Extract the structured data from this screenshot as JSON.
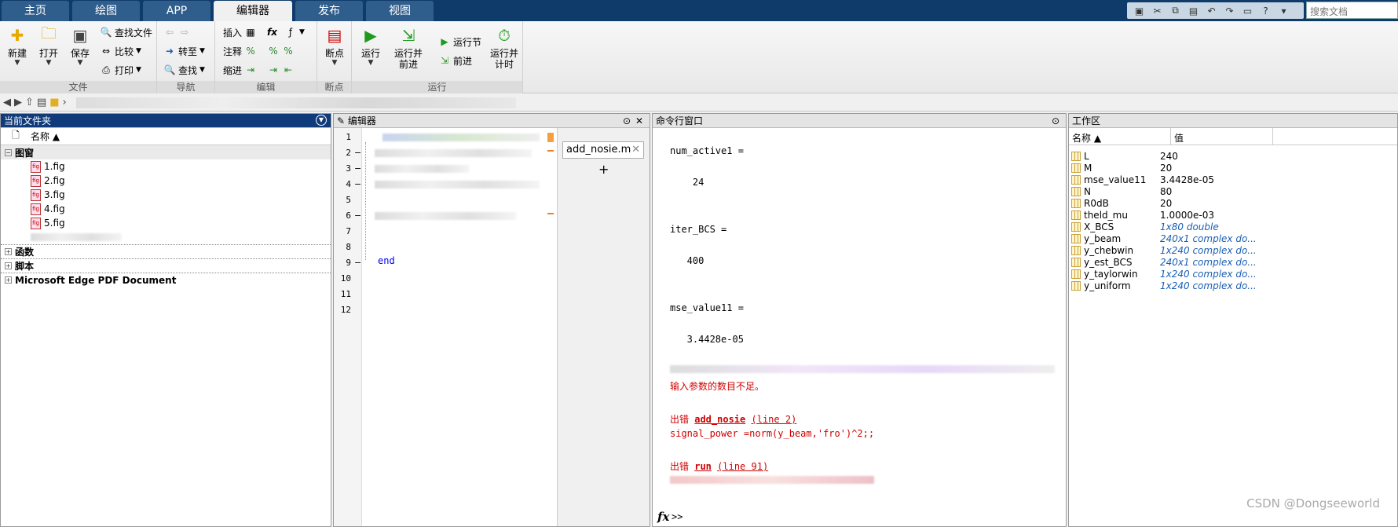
{
  "tabs": [
    {
      "label": "主页",
      "active": false
    },
    {
      "label": "绘图",
      "active": false
    },
    {
      "label": "APP",
      "active": false
    },
    {
      "label": "编辑器",
      "active": true
    },
    {
      "label": "发布",
      "active": false
    },
    {
      "label": "视图",
      "active": false
    }
  ],
  "search_placeholder": "搜索文档",
  "toolstrip": {
    "file": {
      "title": "文件",
      "new": "新建",
      "open": "打开",
      "save": "保存",
      "find_files": "查找文件",
      "compare": "比较",
      "print": "打印"
    },
    "nav": {
      "title": "导航",
      "goto": "转至",
      "find": "查找"
    },
    "edit": {
      "title": "编辑",
      "insert": "插入",
      "comment": "注释",
      "indent": "缩进",
      "fx": "fx"
    },
    "breakpoints": {
      "title": "断点",
      "bp": "断点"
    },
    "run": {
      "title": "运行",
      "run": "运行",
      "run_advance_1": "运行并",
      "run_advance_2": "前进",
      "run_section": "运行节",
      "advance": "前进",
      "run_time_1": "运行并",
      "run_time_2": "计时"
    }
  },
  "files_panel": {
    "title": "当前文件夹",
    "col_name": "名称 ▲",
    "groups": [
      {
        "label": "图窗",
        "expanded": true,
        "items": [
          "1.fig",
          "2.fig",
          "3.fig",
          "4.fig",
          "5.fig"
        ]
      },
      {
        "label": "函数",
        "expanded": false,
        "items": []
      },
      {
        "label": "脚本",
        "expanded": false,
        "items": []
      },
      {
        "label": "Microsoft Edge PDF Document",
        "expanded": false,
        "items": []
      }
    ]
  },
  "editor_panel": {
    "title": "编辑器",
    "line_numbers": [
      "1",
      "2",
      "3",
      "4",
      "5",
      "6",
      "7",
      "8",
      "9",
      "10",
      "11",
      "12"
    ],
    "end_keyword": "end",
    "open_file": "add_nosie.m",
    "add_tab": "+"
  },
  "command_panel": {
    "title": "命令行窗口",
    "lines": [
      {
        "text": "num_active1 =",
        "kind": "normal"
      },
      {
        "text": "    24",
        "kind": "normal"
      },
      {
        "text": "iter_BCS =",
        "kind": "normal"
      },
      {
        "text": "   400",
        "kind": "normal"
      },
      {
        "text": "mse_value11 =",
        "kind": "normal"
      },
      {
        "text": "   3.4428e-05",
        "kind": "normal"
      }
    ],
    "error_msg": "输入参数的数目不足。",
    "err1_prefix": "出错 ",
    "err1_func": "add_nosie",
    "err1_line": "(line 2)",
    "err1_code": "signal_power =norm(y_beam,'fro')^2;;",
    "err2_prefix": "出错 ",
    "err2_func": "run",
    "err2_line": "(line 91)",
    "prompt": ">>",
    "fx": "fx"
  },
  "workspace_panel": {
    "title": "工作区",
    "col_name": "名称 ▲",
    "col_value": "值",
    "vars": [
      {
        "name": "L",
        "value": "240",
        "italic": false
      },
      {
        "name": "M",
        "value": "20",
        "italic": false
      },
      {
        "name": "mse_value11",
        "value": "3.4428e-05",
        "italic": false
      },
      {
        "name": "N",
        "value": "80",
        "italic": false
      },
      {
        "name": "R0dB",
        "value": "20",
        "italic": false
      },
      {
        "name": "theld_mu",
        "value": "1.0000e-03",
        "italic": false
      },
      {
        "name": "X_BCS",
        "value": "1x80 double",
        "italic": true
      },
      {
        "name": "y_beam",
        "value": "240x1 complex do...",
        "italic": true
      },
      {
        "name": "y_chebwin",
        "value": "1x240 complex do...",
        "italic": true
      },
      {
        "name": "y_est_BCS",
        "value": "240x1 complex do...",
        "italic": true
      },
      {
        "name": "y_taylorwin",
        "value": "1x240 complex do...",
        "italic": true
      },
      {
        "name": "y_uniform",
        "value": "1x240 complex do...",
        "italic": true
      }
    ]
  },
  "watermark": "CSDN @Dongseeworld"
}
